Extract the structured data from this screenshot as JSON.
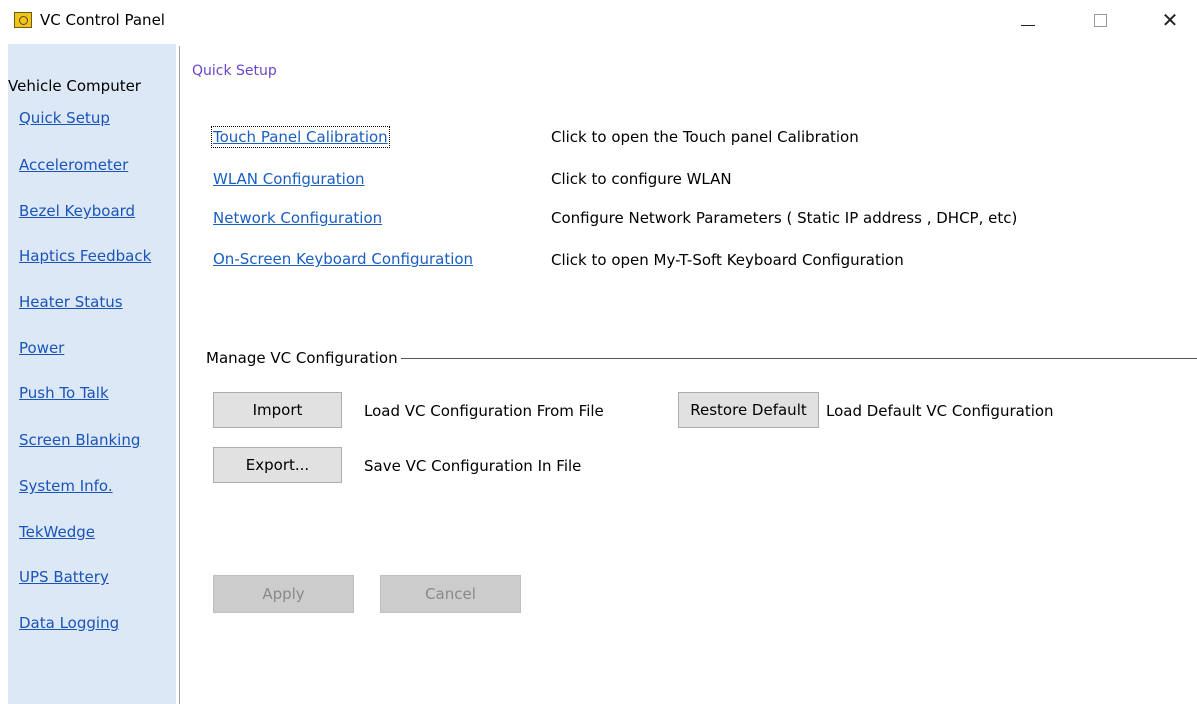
{
  "window": {
    "title": "VC Control Panel",
    "minimize_label": "—",
    "maximize_label": "",
    "close_label": "✕"
  },
  "sidebar": {
    "heading": "Vehicle Computer",
    "items": [
      {
        "label": "Quick Setup"
      },
      {
        "label": "Accelerometer"
      },
      {
        "label": "Bezel Keyboard"
      },
      {
        "label": "Haptics Feedback"
      },
      {
        "label": "Heater Status"
      },
      {
        "label": "Power"
      },
      {
        "label": "Push To Talk"
      },
      {
        "label": "Screen Blanking"
      },
      {
        "label": "System Info."
      },
      {
        "label": "TekWedge"
      },
      {
        "label": "UPS Battery"
      },
      {
        "label": "Data Logging"
      }
    ]
  },
  "main": {
    "title": "Quick Setup",
    "links": [
      {
        "label": "Touch Panel Calibration",
        "description": "Click to open the Touch panel Calibration"
      },
      {
        "label": "WLAN Configuration",
        "description": "Click to configure WLAN"
      },
      {
        "label": "Network Configuration",
        "description": "Configure Network Parameters ( Static IP address , DHCP, etc)"
      },
      {
        "label": "On-Screen Keyboard Configuration",
        "description": "Click to open My-T-Soft Keyboard Configuration"
      }
    ],
    "manage": {
      "group_label": "Manage VC Configuration",
      "import_label": "Import",
      "import_desc": "Load VC Configuration From File",
      "restore_label": "Restore Default",
      "restore_desc": "Load Default VC Configuration",
      "export_label": "Export...",
      "export_desc": "Save VC Configuration In File"
    },
    "footer": {
      "apply_label": "Apply",
      "cancel_label": "Cancel"
    }
  },
  "colors": {
    "sidebar_bg": "#dde8f6",
    "link": "#1a5fbf",
    "page_title": "#6a45c9"
  }
}
